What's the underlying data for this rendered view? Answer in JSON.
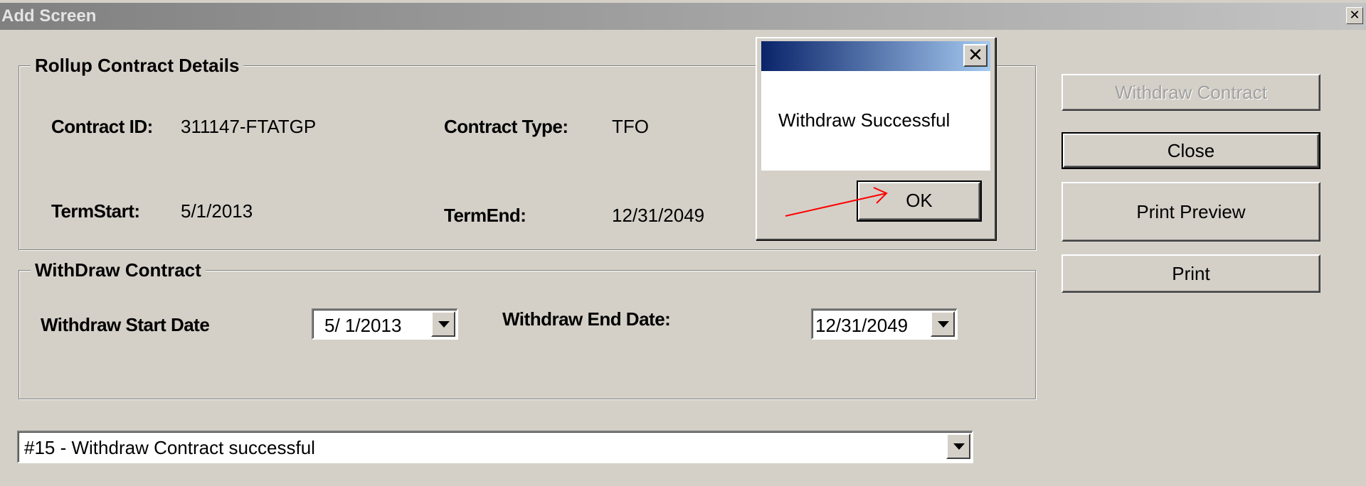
{
  "window": {
    "title": "Add Screen",
    "close_glyph": "✕"
  },
  "rollup": {
    "legend": "Rollup Contract Details",
    "contract_id_label": "Contract ID:",
    "contract_id_value": "311147-FTATGP",
    "contract_type_label": "Contract Type:",
    "contract_type_value": "TFO",
    "term_start_label": "TermStart:",
    "term_start_value": "5/1/2013",
    "term_end_label": "TermEnd:",
    "term_end_value": "12/31/2049"
  },
  "withdraw": {
    "legend": "WithDraw Contract",
    "start_label": "Withdraw Start Date",
    "start_value": "5/  1/2013",
    "end_label": "Withdraw End Date:",
    "end_value": "12/31/2049"
  },
  "status_combo": {
    "value": "#15 - Withdraw Contract  successful"
  },
  "buttons": {
    "withdraw_contract": "Withdraw Contract",
    "close": "Close",
    "print_preview": "Print Preview",
    "print": "Print"
  },
  "dialog": {
    "message": "Withdraw Successful",
    "ok_label": "OK",
    "close_glyph": "✕"
  },
  "colors": {
    "window_bg": "#d4d0c8",
    "dialog_title_start": "#0a246a",
    "dialog_title_end": "#a6caf0",
    "annotation_arrow": "#ff0000"
  }
}
